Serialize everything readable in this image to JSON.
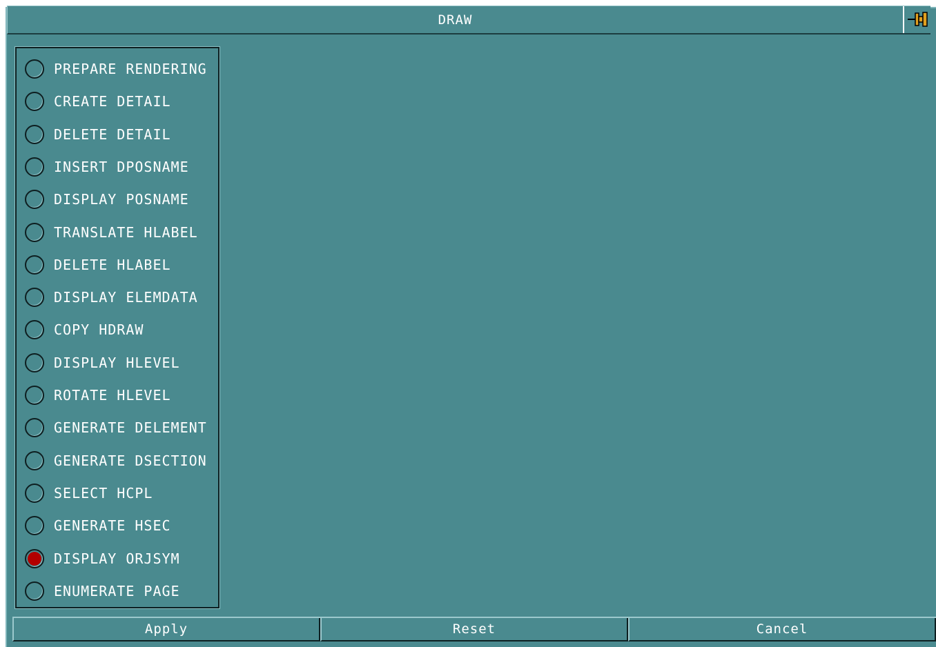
{
  "window": {
    "title": "DRAW"
  },
  "menu": {
    "items": [
      {
        "label": "PREPARE RENDERING",
        "selected": false
      },
      {
        "label": "CREATE DETAIL",
        "selected": false
      },
      {
        "label": "DELETE DETAIL",
        "selected": false
      },
      {
        "label": "INSERT DPOSNAME",
        "selected": false
      },
      {
        "label": "DISPLAY POSNAME",
        "selected": false
      },
      {
        "label": "TRANSLATE HLABEL",
        "selected": false
      },
      {
        "label": "DELETE HLABEL",
        "selected": false
      },
      {
        "label": "DISPLAY ELEMDATA",
        "selected": false
      },
      {
        "label": "COPY HDRAW",
        "selected": false
      },
      {
        "label": "DISPLAY HLEVEL",
        "selected": false
      },
      {
        "label": "ROTATE HLEVEL",
        "selected": false
      },
      {
        "label": "GENERATE DELEMENT",
        "selected": false
      },
      {
        "label": "GENERATE DSECTION",
        "selected": false
      },
      {
        "label": "SELECT HCPL",
        "selected": false
      },
      {
        "label": "GENERATE HSEC",
        "selected": false
      },
      {
        "label": "DISPLAY ORJSYM",
        "selected": true
      },
      {
        "label": "ENUMERATE PAGE",
        "selected": false
      }
    ]
  },
  "buttons": {
    "apply": "Apply",
    "reset": "Reset",
    "cancel": "Cancel"
  },
  "colors": {
    "background": "#4a8a8f",
    "selected_radio": "#b30000",
    "text": "#ffffff"
  }
}
